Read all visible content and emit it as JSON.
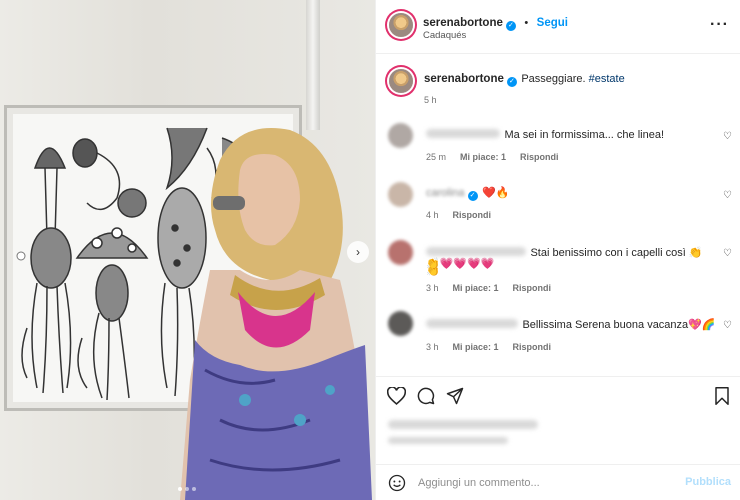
{
  "post": {
    "author": "serenabortone",
    "follow_label": "Segui",
    "location": "Cadaqués",
    "caption_text": "Passeggiare. ",
    "caption_hashtag": "#estate",
    "time_ago": "5 h"
  },
  "comments": [
    {
      "text": "Ma sei in formissima... che linea!",
      "time": "25 m",
      "likes": "Mi piace: 1",
      "reply": "Rispondi"
    },
    {
      "visible_name": "carolina",
      "text": "❤️🔥",
      "time": "4 h",
      "reply": "Rispondi"
    },
    {
      "text": "Stai benissimo con i capelli così 👏👏",
      "text2": "👏💗💗💗💗",
      "time": "3 h",
      "likes": "Mi piace: 1",
      "reply": "Rispondi"
    },
    {
      "text": "Bellissima Serena buona vacanza💖🌈",
      "time": "3 h",
      "likes": "Mi piace: 1",
      "reply": "Rispondi"
    }
  ],
  "add_comment": {
    "placeholder": "Aggiungi un commento...",
    "publish_label": "Pubblica"
  },
  "icons": [
    "heart-icon",
    "comment-icon",
    "share-icon",
    "bookmark-icon",
    "emoji-icon",
    "more-icon",
    "verified-icon",
    "chevron-right-icon"
  ],
  "colors": {
    "accent": "#0095f6",
    "hashtag": "#00376b",
    "publish_disabled": "#b2dffc"
  }
}
